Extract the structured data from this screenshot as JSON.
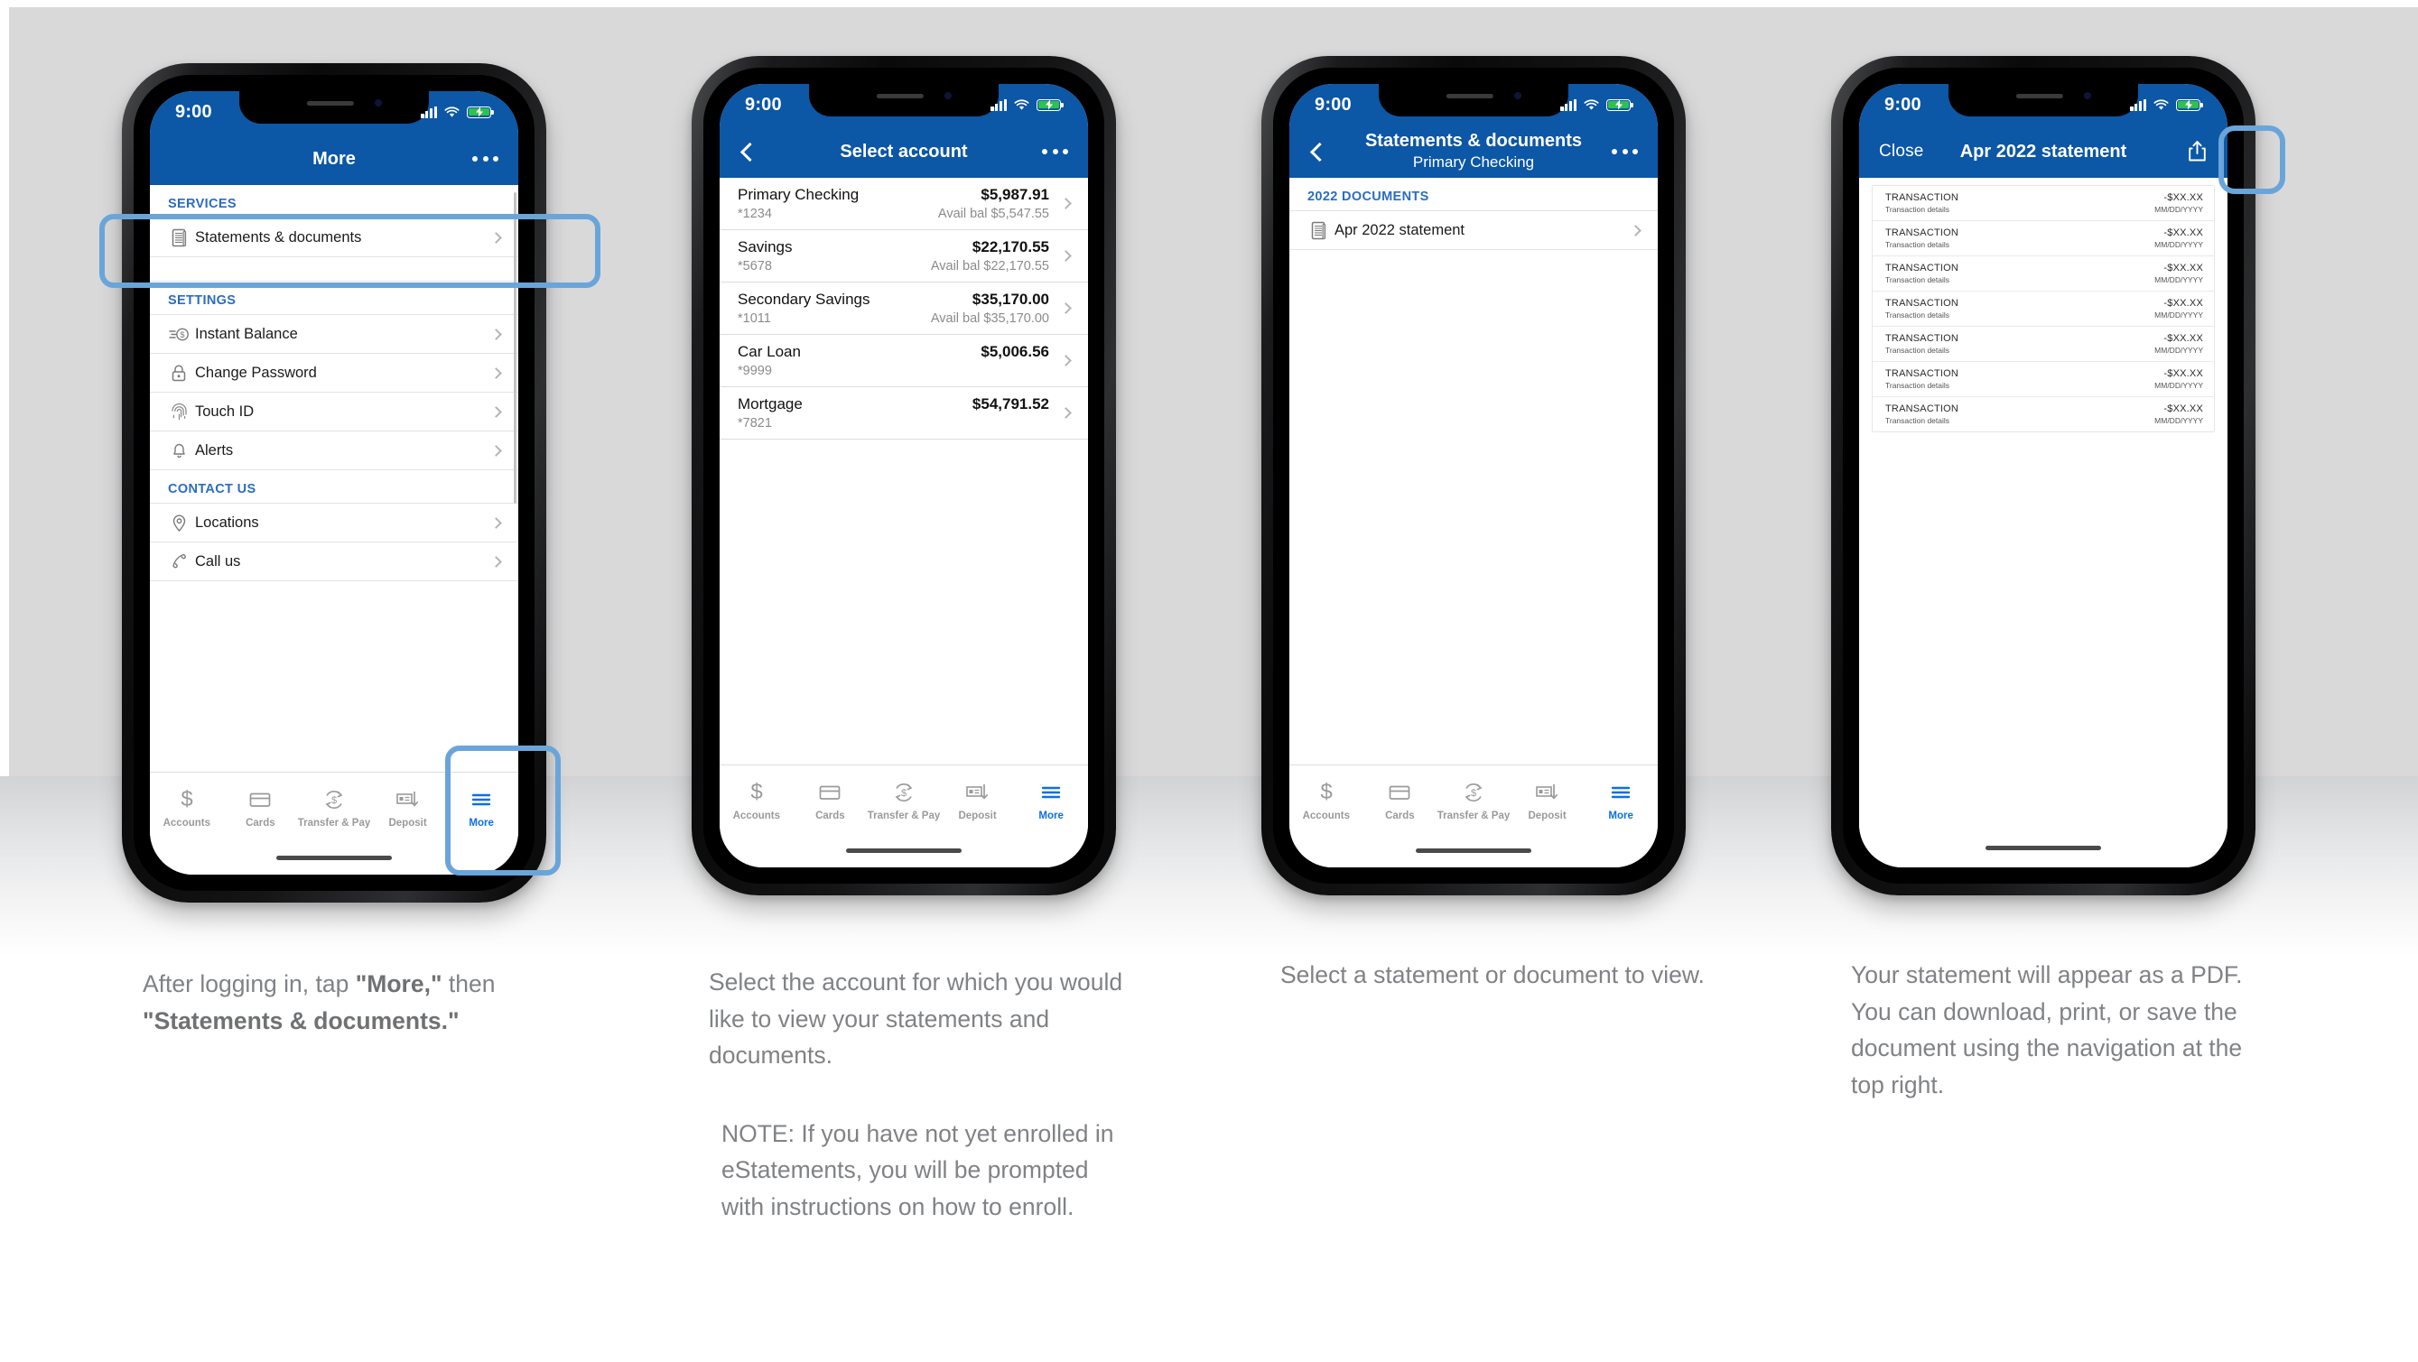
{
  "theme": {
    "brand_blue": "#0c57a6",
    "accent_blue": "#2b6dc0",
    "highlight_blue": "#6aa5da",
    "active_tab_blue": "#0e6fe0",
    "battery_green": "#2fc14d",
    "caption_gray": "#808285",
    "background_gray": "#d9d9da"
  },
  "status_bar": {
    "time": "9:00"
  },
  "tabbar": {
    "items": [
      {
        "label": "Accounts",
        "icon": "dollar-sign-icon",
        "active": false
      },
      {
        "label": "Cards",
        "icon": "credit-card-icon",
        "active": false
      },
      {
        "label": "Transfer & Pay",
        "icon": "transfer-circle-icon",
        "active": false
      },
      {
        "label": "Deposit",
        "icon": "check-deposit-icon",
        "active": false
      },
      {
        "label": "More",
        "icon": "hamburger-menu-icon",
        "active": true
      }
    ]
  },
  "screens": [
    {
      "id": "more",
      "nav": {
        "title": "More",
        "right_icon": "overflow-dots-icon",
        "back": false
      },
      "sections": [
        {
          "header": "SERVICES",
          "rows": [
            {
              "label": "Statements & documents",
              "icon": "document-icon"
            }
          ]
        },
        {
          "header": "SETTINGS",
          "rows": [
            {
              "label": "Instant Balance",
              "icon": "instant-balance-icon"
            },
            {
              "label": "Change Password",
              "icon": "lock-icon"
            },
            {
              "label": "Touch ID",
              "icon": "fingerprint-icon"
            },
            {
              "label": "Alerts",
              "icon": "bell-icon"
            }
          ]
        },
        {
          "header": "CONTACT US",
          "rows": [
            {
              "label": "Locations",
              "icon": "map-pin-icon"
            },
            {
              "label": "Call us",
              "icon": "phone-icon"
            }
          ]
        }
      ]
    },
    {
      "id": "select-account",
      "nav": {
        "title": "Select account",
        "right_icon": "overflow-dots-icon",
        "back": true
      },
      "accounts": [
        {
          "name": "Primary Checking",
          "mask": "*1234",
          "balance": "$5,987.91",
          "available": "Avail bal $5,547.55"
        },
        {
          "name": "Savings",
          "mask": "*5678",
          "balance": "$22,170.55",
          "available": "Avail bal $22,170.55"
        },
        {
          "name": "Secondary Savings",
          "mask": "*1011",
          "balance": "$35,170.00",
          "available": "Avail bal $35,170.00"
        },
        {
          "name": "Car Loan",
          "mask": "*9999",
          "balance": "$5,006.56",
          "available": ""
        },
        {
          "name": "Mortgage",
          "mask": "*7821",
          "balance": "$54,791.52",
          "available": ""
        }
      ]
    },
    {
      "id": "statements-documents",
      "nav": {
        "title": "Statements & documents",
        "subtitle": "Primary Checking",
        "right_icon": "overflow-dots-icon",
        "back": true
      },
      "section_header": "2022 DOCUMENTS",
      "documents": [
        {
          "label": "Apr 2022 statement",
          "icon": "document-icon"
        }
      ]
    },
    {
      "id": "statement-pdf",
      "nav": {
        "close_label": "Close",
        "title": "Apr 2022 statement",
        "right_icon": "share-icon"
      },
      "transactions": [
        {
          "title": "TRANSACTION",
          "details": "Transaction details",
          "amount": "-$XX.XX",
          "date": "MM/DD/YYYY"
        },
        {
          "title": "TRANSACTION",
          "details": "Transaction details",
          "amount": "-$XX.XX",
          "date": "MM/DD/YYYY"
        },
        {
          "title": "TRANSACTION",
          "details": "Transaction details",
          "amount": "-$XX.XX",
          "date": "MM/DD/YYYY"
        },
        {
          "title": "TRANSACTION",
          "details": "Transaction details",
          "amount": "-$XX.XX",
          "date": "MM/DD/YYYY"
        },
        {
          "title": "TRANSACTION",
          "details": "Transaction details",
          "amount": "-$XX.XX",
          "date": "MM/DD/YYYY"
        },
        {
          "title": "TRANSACTION",
          "details": "Transaction details",
          "amount": "-$XX.XX",
          "date": "MM/DD/YYYY"
        },
        {
          "title": "TRANSACTION",
          "details": "Transaction details",
          "amount": "-$XX.XX",
          "date": "MM/DD/YYYY"
        }
      ]
    }
  ],
  "captions": {
    "step1": {
      "plain1": "After logging in, tap ",
      "bold1": "\"More,\"",
      "plain2": " then ",
      "bold2": "\"Statements & documents.\""
    },
    "step2": {
      "text": "Select the account for which you would like to view your statements and documents.",
      "note": "NOTE: If you have not yet enrolled in eStatements, you will be prompted with instructions on how to enroll."
    },
    "step3": {
      "text": "Select a statement or document to view."
    },
    "step4": {
      "text": "Your statement will appear as a PDF. You can download, print, or save the document using the navigation at the top right."
    }
  }
}
